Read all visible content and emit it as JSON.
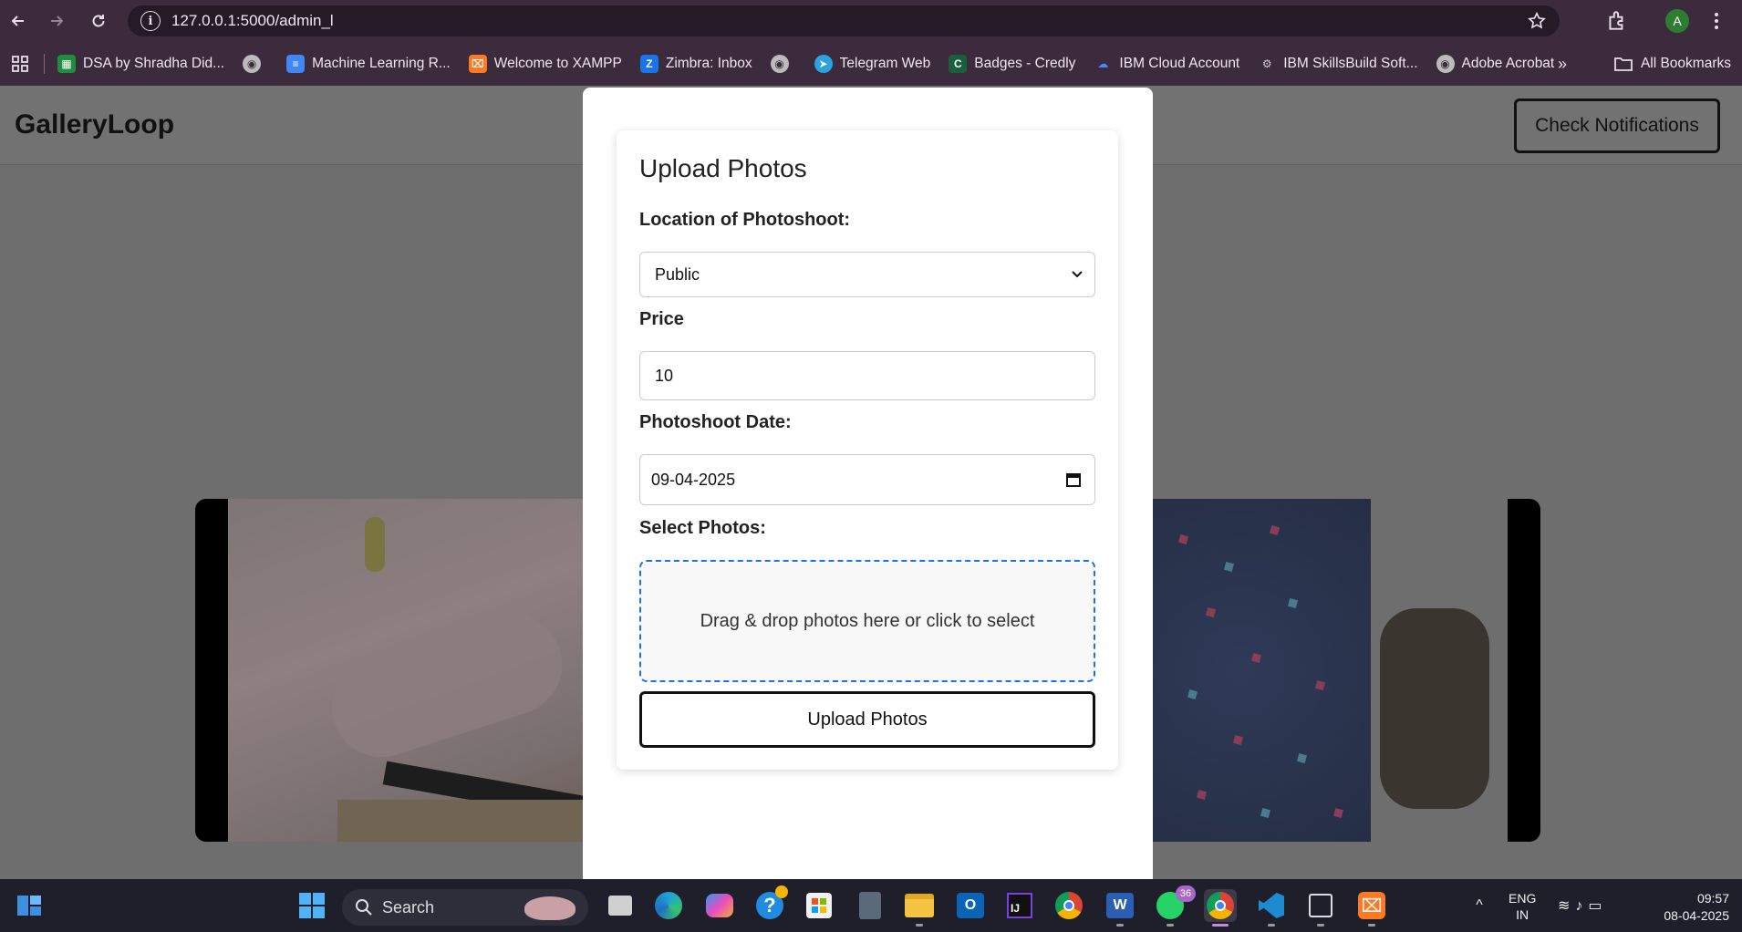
{
  "browser": {
    "url": "127.0.0.1:5000/admin_l",
    "profile_initial": "A",
    "bookmarks": [
      {
        "label": "DSA by Shradha Did...",
        "icon": "sheets-icon",
        "color": "#1e8e3e"
      },
      {
        "label": "",
        "icon": "globe-icon",
        "color": "#bbbbbb"
      },
      {
        "label": "Machine Learning R...",
        "icon": "docs-icon",
        "color": "#4285f4"
      },
      {
        "label": "Welcome to XAMPP",
        "icon": "xampp-icon",
        "color": "#fb7a24"
      },
      {
        "label": "Zimbra: Inbox",
        "icon": "zimbra-icon",
        "color": "#1a73e8"
      },
      {
        "label": "",
        "icon": "globe-icon",
        "color": "#bbbbbb"
      },
      {
        "label": "Telegram Web",
        "icon": "telegram-icon",
        "color": "#2aa3df"
      },
      {
        "label": "Badges - Credly",
        "icon": "credly-icon",
        "color": "#1b5e3b"
      },
      {
        "label": "IBM Cloud Account",
        "icon": "ibm-icon",
        "color": "#4589ff"
      },
      {
        "label": "IBM SkillsBuild Soft...",
        "icon": "skillsbuild-icon",
        "color": "#cccccc"
      },
      {
        "label": "Adobe Acrobat",
        "icon": "globe-icon",
        "color": "#bbbbbb"
      }
    ],
    "all_bookmarks": "All Bookmarks"
  },
  "site": {
    "brand": "GalleryLoop",
    "notifications_button": "Check Notifications"
  },
  "modal": {
    "title": "Upload Photos",
    "location_label": "Location of Photoshoot:",
    "location_value": "Public",
    "price_label": "Price",
    "price_value": "10",
    "date_label": "Photoshoot Date:",
    "date_value": "09-04-2025",
    "photos_label": "Select Photos:",
    "dropzone_text": "Drag & drop photos here or click to select",
    "upload_button": "Upload Photos"
  },
  "taskbar": {
    "search_label": "Search",
    "whatsapp_badge": "36",
    "lang_top": "ENG",
    "lang_bottom": "IN",
    "time": "09:57",
    "date": "08-04-2025"
  },
  "colors": {
    "accent": "#1a73e8",
    "chrome": "#3c2a3d"
  }
}
